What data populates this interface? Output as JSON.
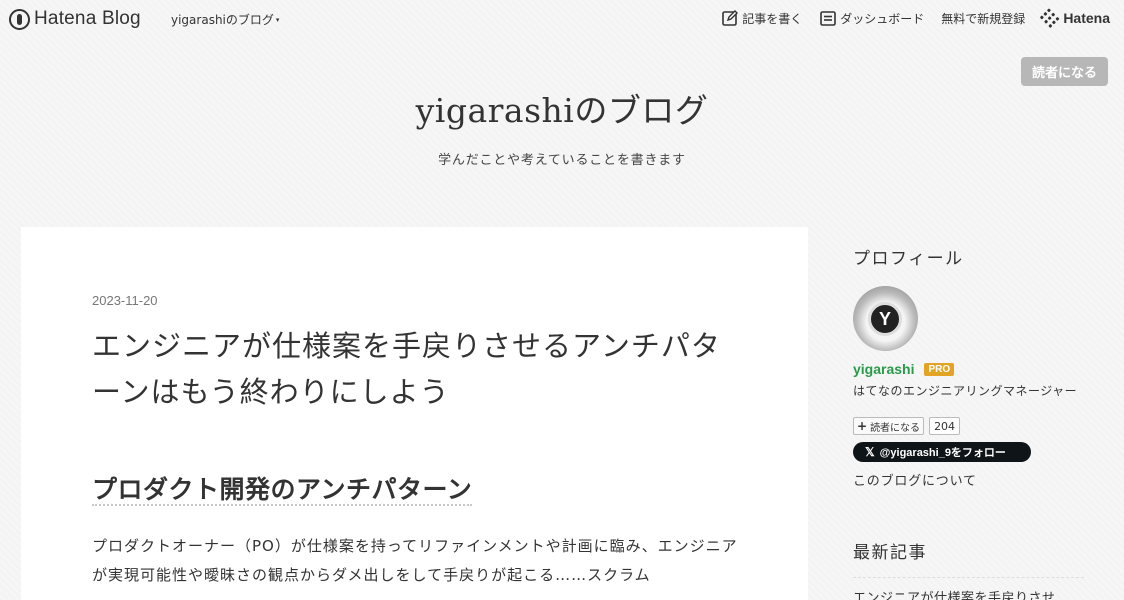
{
  "header": {
    "logo_text": "Hatena Blog",
    "blog_menu_label": "yigarashiのブログ",
    "caret": "▾",
    "write_label": "記事を書く",
    "dashboard_label": "ダッシュボード",
    "signup_label": "無料で新規登録",
    "hatena_label": "Hatena"
  },
  "subscribe": {
    "label": "読者になる"
  },
  "blog": {
    "title": "yigarashiのブログ",
    "description": "学んだことや考えていることを書きます"
  },
  "entry": {
    "date": "2023-11-20",
    "title": "エンジニアが仕様案を手戻りさせるアンチパターンはもう終わりにしよう",
    "heading": "プロダクト開発のアンチパターン",
    "paragraph": "プロダクトオーナー（PO）が仕様案を持ってリファインメントや計画に臨み、エンジニアが実現可能性や曖昧さの観点からダメ出しをして手戻りが起こる……スクラム"
  },
  "sidebar": {
    "profile_title": "プロフィール",
    "avatar_letter": "Y",
    "user_id": "yigarashi",
    "pro_label": "PRO",
    "user_description": "はてなのエンジニアリングマネージャー",
    "reader_button": "読者になる",
    "reader_plus": "+",
    "reader_count": "204",
    "x_logo": "𝕏",
    "follow_label": "@yigarashi_9をフォロー",
    "about_label": "このブログについて",
    "recent_title": "最新記事",
    "recent_item": "エンジニアが仕様案を手戻りさせ"
  },
  "colors": {
    "background": "#f6f6f6",
    "card": "#ffffff",
    "user_id_green": "#2a9a4a",
    "pro_badge": "#e3a325",
    "subscribe_button": "#b7b7b7",
    "follow_button": "#0f1419"
  },
  "icons": {
    "logo": "hatena-blog-logo-icon",
    "write": "pencil-square-icon",
    "dashboard": "dashboard-list-icon",
    "hatena": "hatena-dots-icon"
  }
}
